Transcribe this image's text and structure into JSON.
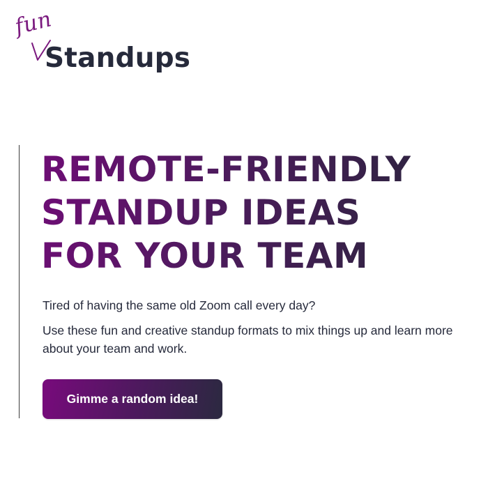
{
  "logo": {
    "accent_word": "fun",
    "brand_word": "Standups",
    "accent_color": "#7b1a7f",
    "brand_color": "#262a3b"
  },
  "hero": {
    "title_lines": [
      "REMOTE-FRIENDLY",
      "STANDUP IDEAS",
      "FOR YOUR TEAM"
    ],
    "intro": "Tired of having the same old Zoom call every day?",
    "description": "Use these fun and creative standup formats to mix things up and learn more about your team and work.",
    "cta_label": "Gimme a random idea!",
    "gradient_start": "#780a7c",
    "gradient_end": "#2b2940"
  }
}
